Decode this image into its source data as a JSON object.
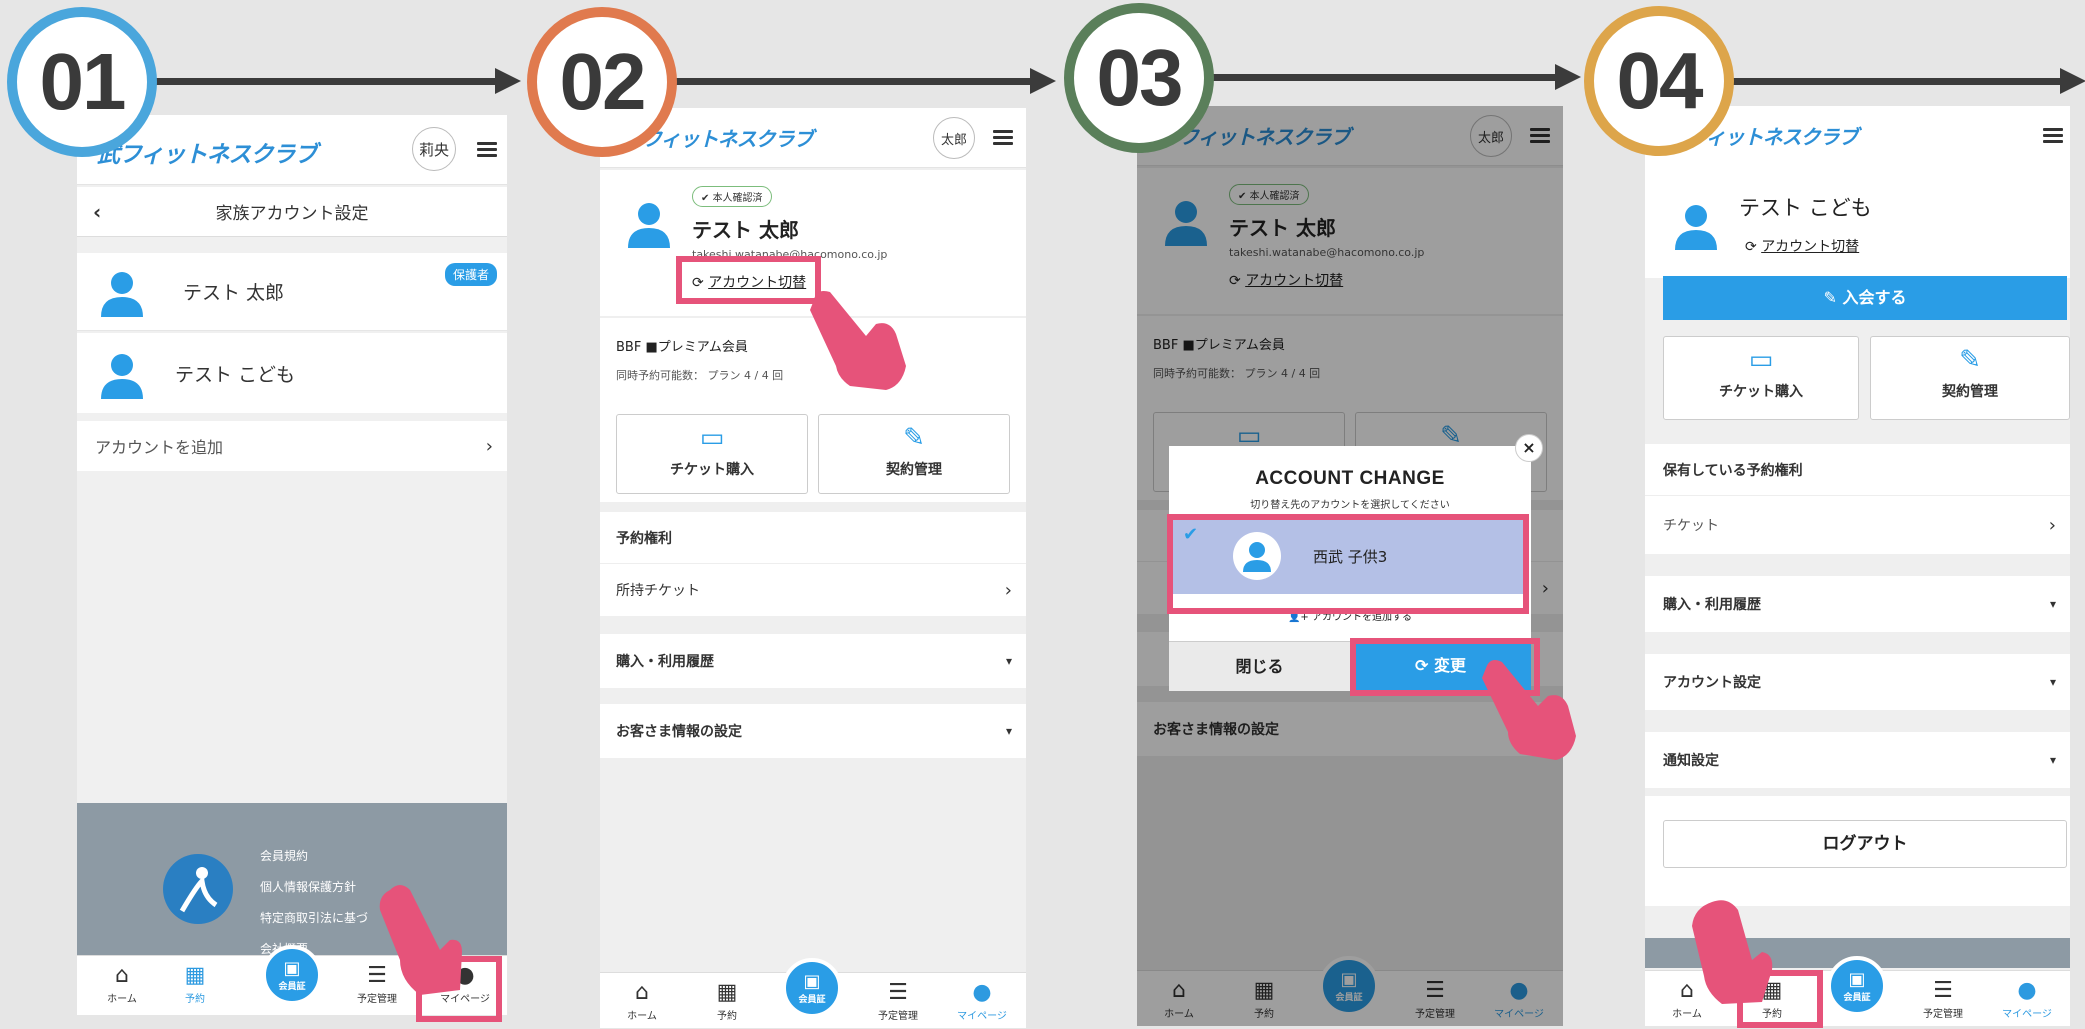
{
  "steps": [
    "01",
    "02",
    "03",
    "04"
  ],
  "colors": {
    "step1": "#4aa6dc",
    "step2": "#e07a4e",
    "step3": "#5a7f5a",
    "step4": "#dda54a",
    "highlight": "#e6537a",
    "brand": "#2a9de6"
  },
  "screen1": {
    "logo": "武フィットネスクラブ",
    "avatar": "莉央",
    "title": "家族アカウント設定",
    "members": [
      {
        "name": "テスト 太郎",
        "badge": "保護者"
      },
      {
        "name": "テスト こども"
      }
    ],
    "add_account": "アカウントを追加",
    "footer_links": [
      "会員規約",
      "個人情報保護方針",
      "特定商取引法に基づ",
      "会社概要"
    ],
    "tabs": {
      "home": "ホーム",
      "reserve": "予約",
      "member": "会員証",
      "schedule": "予定管理",
      "mypage": "マイページ"
    }
  },
  "screen2": {
    "logo": "フィットネスクラブ",
    "avatar": "太郎",
    "verified": "本人確認済",
    "name": "テスト 太郎",
    "email": "takeshi.watanabe@hacomono.co.jp",
    "switch": "アカウント切替",
    "membership": "BBF ■プレミアム会員",
    "concurrent": "同時予約可能数： プラン 4 / 4 回",
    "ticket_btn": "チケット購入",
    "contract_btn": "契約管理",
    "rights": "予約権利",
    "tickets": "所持チケット",
    "history": "購入・利用履歴",
    "customer": "お客さま情報の設定",
    "tabs": {
      "home": "ホーム",
      "reserve": "予約",
      "member": "会員証",
      "schedule": "予定管理",
      "mypage": "マイページ"
    }
  },
  "screen3": {
    "logo": "フィットネスクラブ",
    "avatar": "太郎",
    "verified": "本人確認済",
    "name": "テスト 太郎",
    "email": "takeshi.watanabe@hacomono.co.jp",
    "switch": "アカウント切替",
    "membership": "BBF ■プレミアム会員",
    "concurrent": "同時予約可能数： プラン 4 / 4 回",
    "customer": "お客さま情報の設定",
    "modal": {
      "title": "ACCOUNT CHANGE",
      "subtitle": "切り替え先のアカウントを選択してください",
      "account": "西武 子供3",
      "add": "アカウントを追加する",
      "close": "閉じる",
      "change": "変更"
    },
    "tabs": {
      "home": "ホーム",
      "reserve": "予約",
      "member": "会員証",
      "schedule": "予定管理",
      "mypage": "マイページ"
    }
  },
  "screen4": {
    "logo": "フィットネスクラブ",
    "name": "テスト こども",
    "switch": "アカウント切替",
    "join": "入会する",
    "ticket_btn": "チケット購入",
    "contract_btn": "契約管理",
    "rights": "保有している予約権利",
    "ticket": "チケット",
    "history": "購入・利用履歴",
    "account_settings": "アカウント設定",
    "notification": "通知設定",
    "logout": "ログアウト",
    "tabs": {
      "home": "ホーム",
      "reserve": "予約",
      "member": "会員証",
      "schedule": "予定管理",
      "mypage": "マイページ"
    }
  }
}
